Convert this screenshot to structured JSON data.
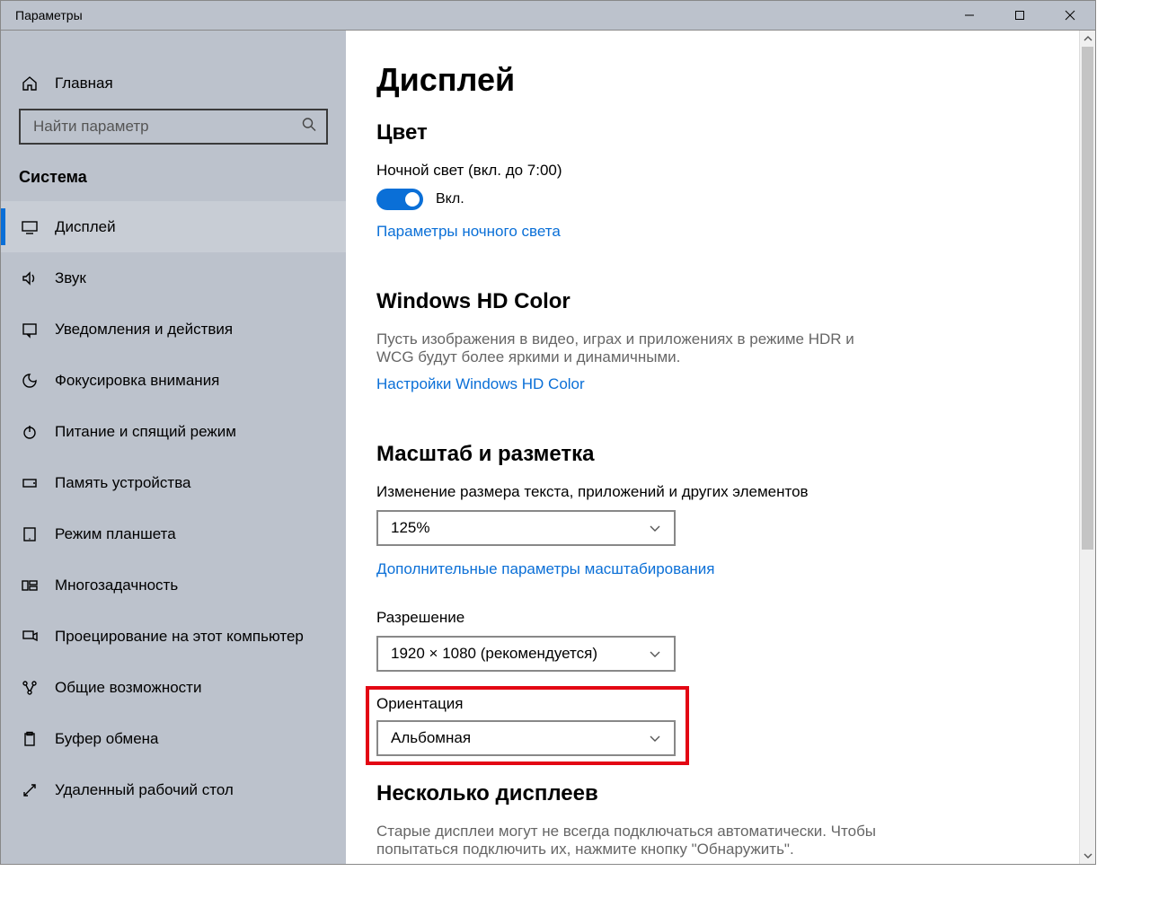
{
  "titlebar": {
    "title": "Параметры"
  },
  "sidebar": {
    "home": "Главная",
    "search_placeholder": "Найти параметр",
    "category": "Система",
    "items": [
      "Дисплей",
      "Звук",
      "Уведомления и действия",
      "Фокусировка внимания",
      "Питание и спящий режим",
      "Память устройства",
      "Режим планшета",
      "Многозадачность",
      "Проецирование на этот компьютер",
      "Общие возможности",
      "Буфер обмена",
      "Удаленный рабочий стол"
    ]
  },
  "content": {
    "page_title": "Дисплей",
    "color_h": "Цвет",
    "night_label": "Ночной свет (вкл. до 7:00)",
    "night_state": "Вкл.",
    "night_link": "Параметры ночного света",
    "hdr_h": "Windows HD Color",
    "hdr_desc": "Пусть изображения в видео, играх и приложениях в режиме HDR и WCG будут более яркими и динамичными.",
    "hdr_link": "Настройки Windows HD Color",
    "scale_h": "Масштаб и разметка",
    "scale_label": "Изменение размера текста, приложений и других элементов",
    "scale_value": "125%",
    "scale_link": "Дополнительные параметры масштабирования",
    "res_label": "Разрешение",
    "res_value": "1920 × 1080 (рекомендуется)",
    "orient_label": "Ориентация",
    "orient_value": "Альбомная",
    "multi_h": "Несколько дисплеев",
    "multi_desc": "Старые дисплеи могут не всегда подключаться автоматически. Чтобы попытаться подключить их, нажмите кнопку \"Обнаружить\"."
  }
}
